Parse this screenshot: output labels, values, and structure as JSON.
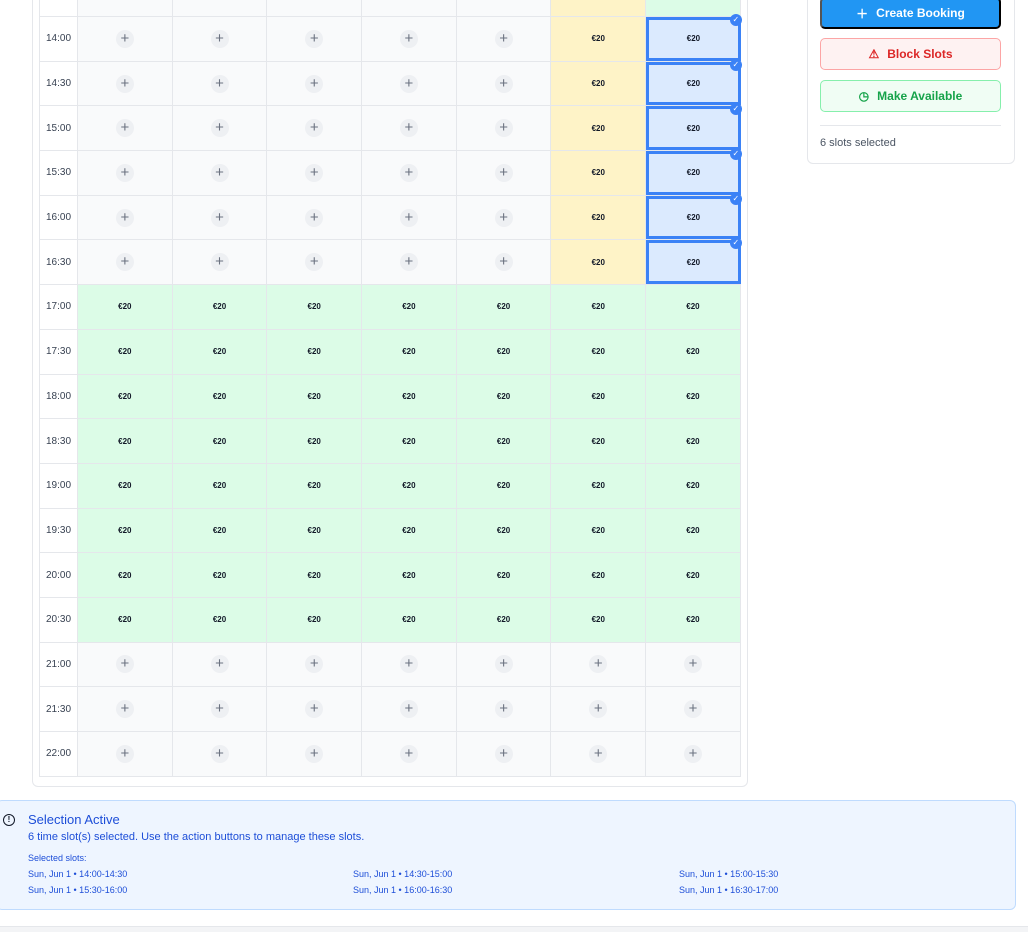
{
  "actions": {
    "create_label": "Create Booking",
    "block_label": "Block Slots",
    "available_label": "Make Available",
    "selected_count": "6 slots selected"
  },
  "schedule": {
    "rows": [
      {
        "time": "14:00",
        "cells": [
          "",
          "",
          "",
          "",
          "",
          "€20",
          "€20"
        ]
      },
      {
        "time": "14:30",
        "cells": [
          "",
          "",
          "",
          "",
          "",
          "€20",
          "€20"
        ]
      },
      {
        "time": "15:00",
        "cells": [
          "",
          "",
          "",
          "",
          "",
          "€20",
          "€20"
        ]
      },
      {
        "time": "15:30",
        "cells": [
          "",
          "",
          "",
          "",
          "",
          "€20",
          "€20"
        ]
      },
      {
        "time": "16:00",
        "cells": [
          "",
          "",
          "",
          "",
          "",
          "€20",
          "€20"
        ]
      },
      {
        "time": "16:30",
        "cells": [
          "",
          "",
          "",
          "",
          "",
          "€20",
          "€20"
        ]
      },
      {
        "time": "17:00",
        "cells": [
          "€20",
          "€20",
          "€20",
          "€20",
          "€20",
          "€20",
          "€20"
        ]
      },
      {
        "time": "17:30",
        "cells": [
          "€20",
          "€20",
          "€20",
          "€20",
          "€20",
          "€20",
          "€20"
        ]
      },
      {
        "time": "18:00",
        "cells": [
          "€20",
          "€20",
          "€20",
          "€20",
          "€20",
          "€20",
          "€20"
        ]
      },
      {
        "time": "18:30",
        "cells": [
          "€20",
          "€20",
          "€20",
          "€20",
          "€20",
          "€20",
          "€20"
        ]
      },
      {
        "time": "19:00",
        "cells": [
          "€20",
          "€20",
          "€20",
          "€20",
          "€20",
          "€20",
          "€20"
        ]
      },
      {
        "time": "19:30",
        "cells": [
          "€20",
          "€20",
          "€20",
          "€20",
          "€20",
          "€20",
          "€20"
        ]
      },
      {
        "time": "20:00",
        "cells": [
          "€20",
          "€20",
          "€20",
          "€20",
          "€20",
          "€20",
          "€20"
        ]
      },
      {
        "time": "20:30",
        "cells": [
          "€20",
          "€20",
          "€20",
          "€20",
          "€20",
          "€20",
          "€20"
        ]
      },
      {
        "time": "21:00",
        "cells": [
          "",
          "",
          "",
          "",
          "",
          "",
          ""
        ]
      },
      {
        "time": "21:30",
        "cells": [
          "",
          "",
          "",
          "",
          "",
          "",
          ""
        ]
      },
      {
        "time": "22:00",
        "cells": [
          "",
          "",
          "",
          "",
          "",
          "",
          ""
        ]
      }
    ]
  },
  "selection": {
    "title": "Selection Active",
    "description": "6 time slot(s) selected. Use the action buttons to manage these slots.",
    "label": "Selected slots:",
    "slots": [
      "Sun, Jun 1 • 14:00-14:30",
      "Sun, Jun 1 • 14:30-15:00",
      "Sun, Jun 1 • 15:00-15:30",
      "Sun, Jun 1 • 15:30-16:00",
      "Sun, Jun 1 • 16:00-16:30",
      "Sun, Jun 1 • 16:30-17:00"
    ]
  },
  "colors": {
    "primary": "#2196f3",
    "available": "#dcfce7",
    "pending": "#fef3c7",
    "selected": "#dbeafe",
    "danger": "#dc2626",
    "success": "#16a34a"
  }
}
